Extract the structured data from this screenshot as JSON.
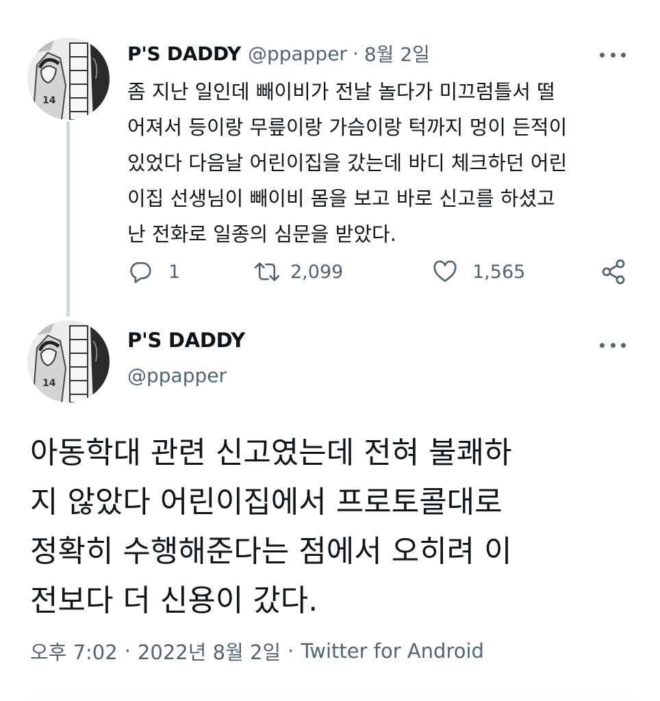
{
  "colors": {
    "text_primary": "#0f1419",
    "text_secondary": "#536471",
    "thread_line": "#cfd9de"
  },
  "tweet_1": {
    "display_name": "P'S DADDY",
    "handle": "@ppapper",
    "separator": "·",
    "date": "8월 2일",
    "more_icon": "more-horizontal-icon",
    "text_lines": [
      "좀 지난 일인데 빼이비가 전날 놀다가 미끄럼틀서 떨",
      "어져서 등이랑 무릎이랑 가슴이랑 턱까지 멍이 든적이",
      "있었다 다음날 어린이집을 갔는데 바디 체크하던 어린",
      "이집 선생님이 빼이비 몸을 보고 바로 신고를 하셨고",
      "난 전화로 일종의 심문을 받았다."
    ],
    "actions": {
      "reply": {
        "icon": "reply-icon",
        "count": "1"
      },
      "retweet": {
        "icon": "retweet-icon",
        "count": "2,099"
      },
      "like": {
        "icon": "heart-icon",
        "count": "1,565"
      },
      "share": {
        "icon": "share-icon"
      }
    }
  },
  "tweet_2": {
    "display_name": "P'S DADDY",
    "handle": "@ppapper",
    "more_icon": "more-horizontal-icon",
    "text_lines": [
      "아동학대 관련 신고였는데 전혀 불쾌하",
      "지 않았다 어린이집에서 프로토콜대로",
      "정확히 수행해준다는 점에서 오히려 이",
      "전보다 더 신용이 갔다."
    ],
    "time": "오후 7:02",
    "separator_1": "·",
    "full_date": "2022년 8월 2일",
    "separator_2": "·",
    "source": "Twitter for Android"
  }
}
